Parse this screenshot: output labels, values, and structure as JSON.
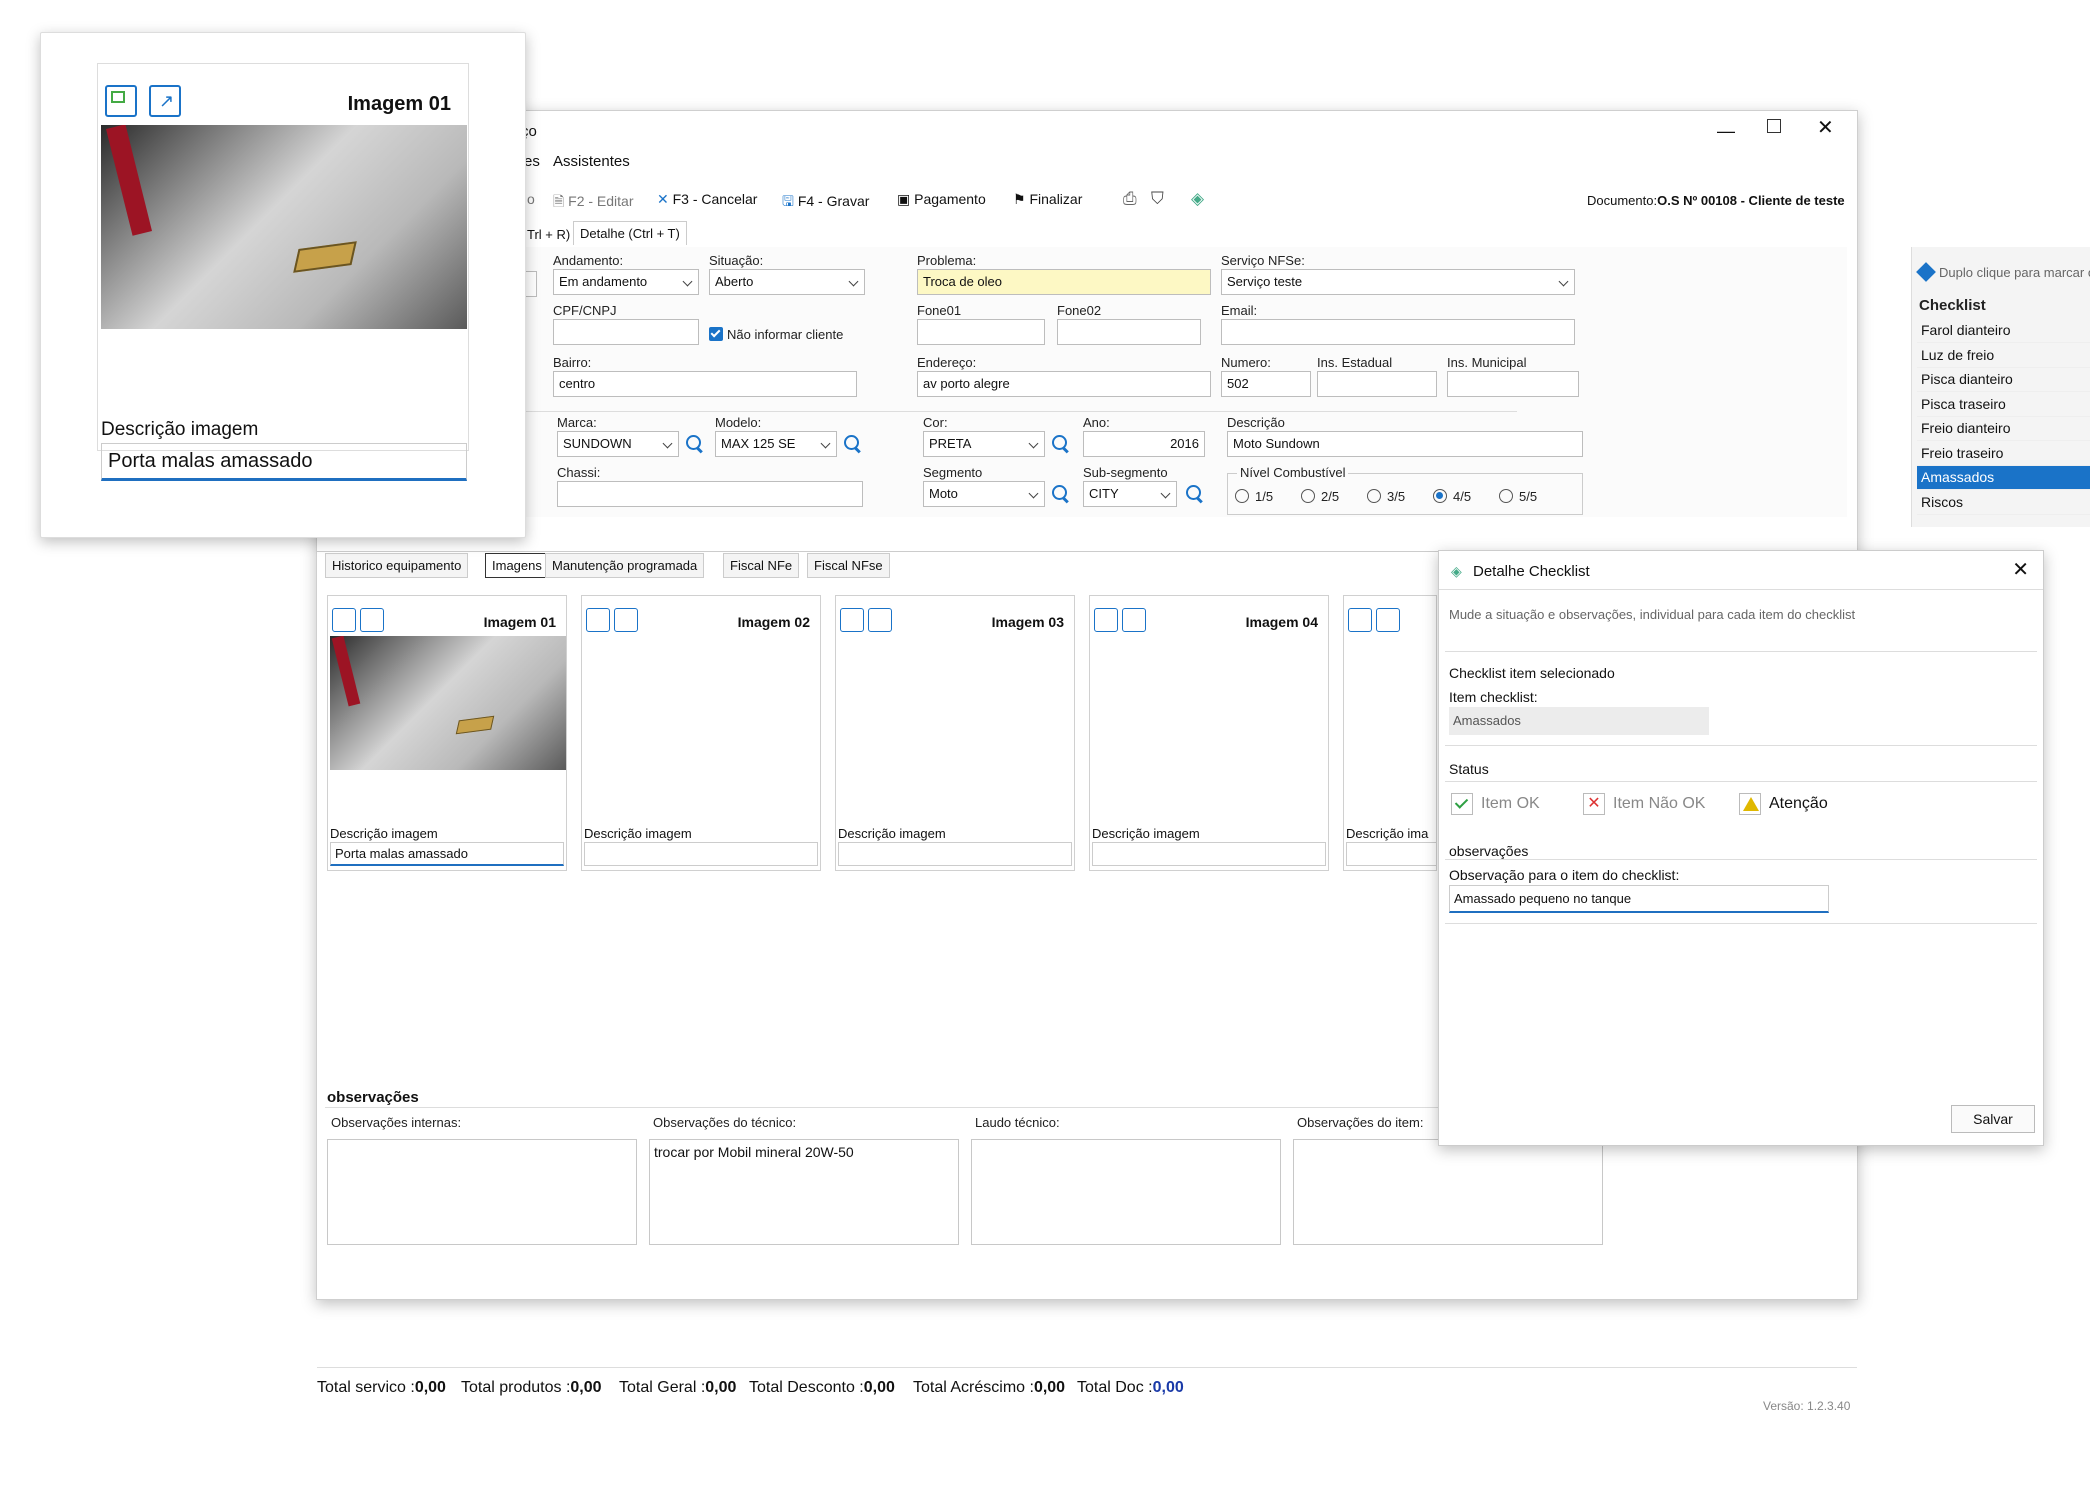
{
  "window": {
    "title_fragment": "ço",
    "menu": {
      "partial": "es",
      "assistentes": "Assistentes"
    }
  },
  "toolbar": {
    "partial": "o",
    "edit": "F2 - Editar",
    "cancel": "F3 - Cancelar",
    "save": "F4 - Gravar",
    "payment": "Pagamento",
    "finish": "Finalizar",
    "document_label": "Documento:",
    "document_value": "O.S Nº 00108 - Cliente de teste"
  },
  "tabs_top": {
    "partial": "Trl + R)",
    "detail": "Detalhe (Ctrl + T)"
  },
  "form": {
    "andamento_label": "Andamento:",
    "andamento_value": "Em andamento",
    "situacao_label": "Situação:",
    "situacao_value": "Aberto",
    "problema_label": "Problema:",
    "problema_value": "Troca de oleo",
    "servico_label": "Serviço NFSe:",
    "servico_value": "Serviço teste",
    "cpf_label": "CPF/CNPJ",
    "nao_informar": "Não informar cliente",
    "fone01_label": "Fone01",
    "fone02_label": "Fone02",
    "email_label": "Email:",
    "bairro_label": "Bairro:",
    "bairro_value": "centro",
    "endereco_label": "Endereço:",
    "endereco_value": "av porto alegre",
    "numero_label": "Numero:",
    "numero_value": "502",
    "ins_estadual_label": "Ins. Estadual",
    "ins_municipal_label": "Ins. Municipal",
    "marca_label": "Marca:",
    "marca_value": "SUNDOWN",
    "modelo_label": "Modelo:",
    "modelo_value": "MAX 125 SE",
    "cor_label": "Cor:",
    "cor_value": "PRETA",
    "ano_label": "Ano:",
    "ano_value": "2016",
    "descricao_label": "Descrição",
    "descricao_value": "Moto Sundown",
    "chassi_label": "Chassi:",
    "segmento_label": "Segmento",
    "segmento_value": "Moto",
    "subsegmento_label": "Sub-segmento",
    "subsegmento_value": "CITY",
    "combustivel_label": "Nível Combustível",
    "combustivel_options": [
      "1/5",
      "2/5",
      "3/5",
      "4/5",
      "5/5"
    ],
    "combustivel_selected": "4/5"
  },
  "checklist": {
    "hint": "Duplo clique para marcar o checklist",
    "title": "Checklist",
    "items": [
      {
        "label": "Farol dianteiro",
        "status": "ok"
      },
      {
        "label": "Luz de freio",
        "status": "ok"
      },
      {
        "label": "Pisca dianteiro",
        "status": "ok"
      },
      {
        "label": "Pisca traseiro",
        "status": "ok"
      },
      {
        "label": "Freio dianteiro",
        "status": "ok"
      },
      {
        "label": "Freio traseiro",
        "status": "ok"
      },
      {
        "label": "Amassados",
        "status": "warn",
        "selected": true
      },
      {
        "label": "Riscos",
        "status": "warn"
      }
    ]
  },
  "tabs_bottom": [
    "Historico equipamento",
    "Imagens",
    "Manutenção programada",
    "Fiscal NFe",
    "Fiscal NFse"
  ],
  "images": [
    {
      "title": "Imagem 01",
      "desc_label": "Descrição imagem",
      "desc_value": "Porta malas amassado"
    },
    {
      "title": "Imagem 02",
      "desc_label": "Descrição imagem",
      "desc_value": ""
    },
    {
      "title": "Imagem 03",
      "desc_label": "Descrição imagem",
      "desc_value": ""
    },
    {
      "title": "Imagem 04",
      "desc_label": "Descrição imagem",
      "desc_value": ""
    },
    {
      "title": "",
      "desc_label": "Descrição ima",
      "desc_value": ""
    }
  ],
  "observacoes": {
    "title": "observações",
    "internas_label": "Observações internas:",
    "tecnico_label": "Observações do técnico:",
    "tecnico_value": "trocar por Mobil mineral 20W-50",
    "laudo_label": "Laudo técnico:",
    "item_label": "Observações do item:"
  },
  "totals": [
    {
      "label": "Total servico :",
      "value": "0,00"
    },
    {
      "label": "Total produtos :",
      "value": "0,00"
    },
    {
      "label": "Total Geral :",
      "value": "0,00"
    },
    {
      "label": "Total Desconto :",
      "value": "0,00"
    },
    {
      "label": "Total Acréscimo :",
      "value": "0,00"
    },
    {
      "label": "Total Doc :",
      "value": "0,00"
    }
  ],
  "version": "Versão: 1.2.3.40",
  "zoom_card": {
    "title": "Imagem 01",
    "desc_label": "Descrição imagem",
    "desc_value": "Porta malas amassado"
  },
  "dialog": {
    "title": "Detalhe Checklist",
    "subtitle": "Mude a situação e observações, individual para cada item do checklist",
    "section_selected": "Checklist item selecionado",
    "item_label": "Item checklist:",
    "item_value": "Amassados",
    "status_label": "Status",
    "status_ok": "Item OK",
    "status_not_ok": "Item Não OK",
    "status_attention": "Atenção",
    "obs_section": "observações",
    "obs_label": "Observação para o item do checklist:",
    "obs_value": "Amassado pequeno no tanque",
    "save": "Salvar"
  },
  "colors": {
    "accent": "#1a73c8",
    "selected_row": "#1a73c8",
    "problem_bg": "#fdf8c4",
    "ok": "#2ea043",
    "warn": "#e0b800"
  }
}
